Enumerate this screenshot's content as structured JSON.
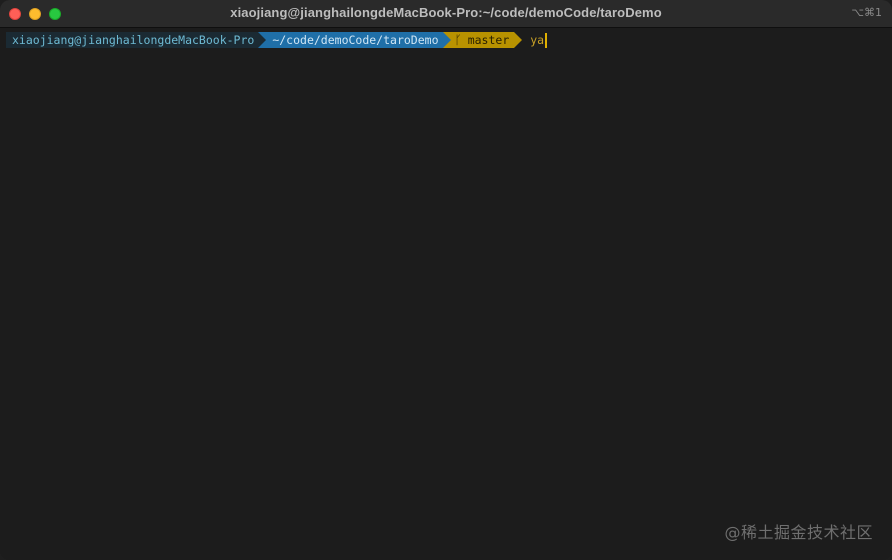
{
  "window": {
    "title": "xiaojiang@jianghailongdeMacBook-Pro:~/code/demoCode/taroDemo",
    "shortcut": "⌥⌘1"
  },
  "prompt": {
    "user_host": "xiaojiang@jianghailongdeMacBook-Pro",
    "directory": "~/code/demoCode/taroDemo",
    "git_branch_icon": "git-branch-icon",
    "git_branch": "master",
    "command_input": "ya"
  },
  "watermark": "@稀土掘金技术社区",
  "colors": {
    "background": "#1c1c1c",
    "user_segment": "#1b2a33",
    "dir_segment": "#1f6fa8",
    "git_segment": "#b89200",
    "cursor": "#e0b000"
  }
}
